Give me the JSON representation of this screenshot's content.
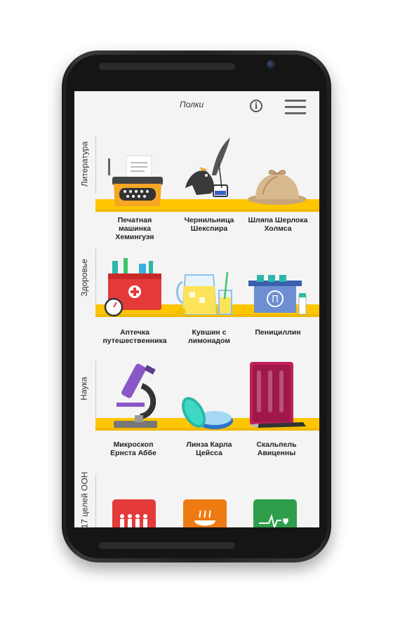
{
  "header": {
    "title": "Полки",
    "info_icon": "info-icon",
    "menu_icon": "hamburger-menu-icon"
  },
  "colors": {
    "shelf": "#fec601",
    "background": "#f4f4f4",
    "red": "#e53a3a",
    "orange": "#ee7a12",
    "green": "#2e9e4b"
  },
  "shelves": [
    {
      "category": "Литература",
      "items": [
        {
          "label": "Печатная машинка Хемингуэя",
          "icon": "typewriter-icon"
        },
        {
          "label": "Чернильница Шекспира",
          "icon": "inkwell-icon"
        },
        {
          "label": "Шляпа Шерлока Холмса",
          "icon": "deerstalker-hat-icon"
        }
      ]
    },
    {
      "category": "Здоровье",
      "items": [
        {
          "label": "Аптечка путешественника",
          "icon": "first-aid-kit-icon"
        },
        {
          "label": "Кувшин с лимонадом",
          "icon": "lemonade-jug-icon"
        },
        {
          "label": "Пенициллин",
          "icon": "penicillin-icon"
        }
      ]
    },
    {
      "category": "Наука",
      "items": [
        {
          "label": "Микроскоп Ернста Аббе",
          "icon": "microscope-icon"
        },
        {
          "label": "Линза Карла Цейсса",
          "icon": "lens-icon"
        },
        {
          "label": "Скальпель Авиценны",
          "icon": "scalpel-icon"
        }
      ]
    },
    {
      "category": "17 целей ООН",
      "items": [
        {
          "icon": "people-icon"
        },
        {
          "icon": "food-bowl-icon"
        },
        {
          "icon": "health-pulse-icon"
        }
      ]
    }
  ]
}
